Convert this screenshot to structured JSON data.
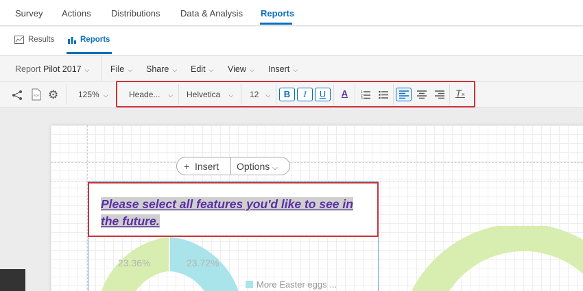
{
  "topnav": {
    "tabs": [
      "Survey",
      "Actions",
      "Distributions",
      "Data & Analysis",
      "Reports"
    ],
    "active": "Reports"
  },
  "subnav": {
    "results_label": "Results",
    "reports_label": "Reports"
  },
  "menubar": {
    "report_label": "Report",
    "report_name": "Pilot 2017",
    "menus": [
      "File",
      "Share",
      "Edit",
      "View",
      "Insert"
    ]
  },
  "toolbar": {
    "zoom": "125%",
    "style": "Heade...",
    "font": "Helvetica",
    "size": "12",
    "bold": "B",
    "italic": "I",
    "underline": "U",
    "text_color": "A",
    "clear": "T"
  },
  "canvas": {
    "insert_label": "Insert",
    "options_label": "Options",
    "title": "Please select all features you'd like to see in the future.",
    "pct_left": "23.36%",
    "pct_right": "23.72%",
    "legend_item": "More Easter eggs ..."
  },
  "colors": {
    "accent": "#0b6ebd",
    "highlight_border": "#c8333b",
    "title_text": "#5b2fa3",
    "donut_green": "#d7eeb0",
    "donut_cyan": "#a9e4ea"
  }
}
